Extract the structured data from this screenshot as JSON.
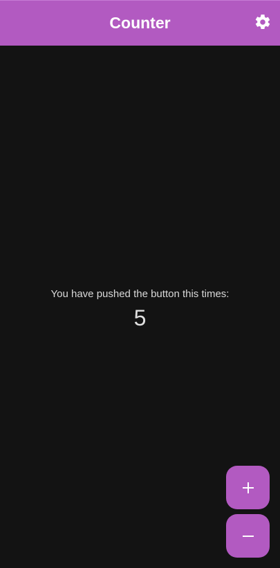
{
  "app_bar": {
    "title": "Counter",
    "settings_icon": "gear-icon"
  },
  "main": {
    "message": "You have pushed the button this times:",
    "count": "5"
  },
  "actions": {
    "increment_icon": "plus-icon",
    "decrement_icon": "minus-icon"
  },
  "colors": {
    "accent": "#b25ac1",
    "background": "#131313",
    "text_primary": "#ffffff",
    "text_secondary": "#d9d9d9"
  }
}
